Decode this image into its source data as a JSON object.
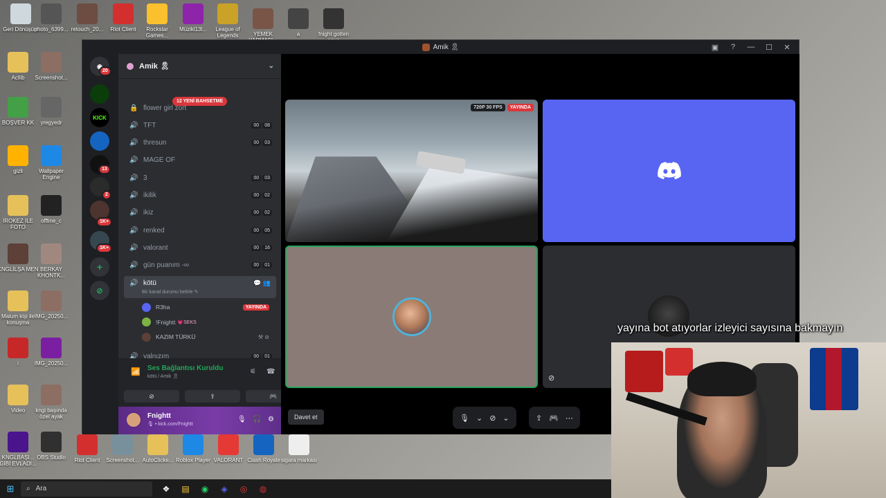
{
  "desktop": {
    "icons": [
      {
        "label": "Geri Dönüşüm",
        "color": "#cfd8dc"
      },
      {
        "label": "photo_6399...",
        "color": "#555"
      },
      {
        "label": "retouch_20...",
        "color": "#6d4c41"
      },
      {
        "label": "Riot Client",
        "color": "#d32f2f"
      },
      {
        "label": "Rockstar Games...",
        "color": "#fbc02d"
      },
      {
        "label": "Müzikl13l...",
        "color": "#8e24aa"
      },
      {
        "label": "League of Legends",
        "color": "#c9a227"
      },
      {
        "label": "YEMEK YAPMASI...",
        "color": "#795548"
      },
      {
        "label": "a",
        "color": "#444"
      },
      {
        "label": "fnight gotten amis",
        "color": "#333"
      },
      {
        "label": "Acllib",
        "color": "#e6c15a"
      },
      {
        "label": "Screenshot...",
        "color": "#8d6e63"
      },
      {
        "label": "BOŞVER KK",
        "color": "#43a047"
      },
      {
        "label": "yregyedr",
        "color": "#666"
      },
      {
        "label": "gizli",
        "color": "#ffb300"
      },
      {
        "label": "Wallpaper Engine",
        "color": "#1e88e5"
      },
      {
        "label": "İROKEZ İLE FOTO",
        "color": "#e6c15a"
      },
      {
        "label": "offline_c",
        "color": "#222"
      },
      {
        "label": "KNGLİLŞA MEN",
        "color": "#5d4037"
      },
      {
        "label": "BERKAY KHONTK...",
        "color": "#a1887f"
      },
      {
        "label": "Malum kişi ile konuşma",
        "color": "#e6c15a"
      },
      {
        "label": "IMG_20250...",
        "color": "#8d6e63"
      },
      {
        "label": "i",
        "color": "#c62828"
      },
      {
        "label": "IMG_20250...",
        "color": "#7b1fa2"
      },
      {
        "label": "Video",
        "color": "#e6c15a"
      },
      {
        "label": "kngi başında özel ayak",
        "color": "#8d6e63"
      },
      {
        "label": "KNGLBAŞI... GİBİ EVLADI...",
        "color": "#4a148c"
      },
      {
        "label": "OBS Studio",
        "color": "#303030"
      }
    ]
  },
  "discord": {
    "window_title": "Amik 🎗",
    "guild_name": "Amik 🎗",
    "mention_pill": "12 YENİ BAHSETME",
    "rail": {
      "home_badge": "20",
      "badges": [
        "13",
        "2",
        "1K+",
        "1K+"
      ],
      "kick_label": "KICK",
      "add_label": "+",
      "explore_label": "⊘"
    },
    "channels": [
      {
        "name": "flower girl zort",
        "locked": true,
        "counts": []
      },
      {
        "name": "TFT",
        "counts": [
          "00",
          "08"
        ]
      },
      {
        "name": "thresun",
        "counts": [
          "00",
          "03"
        ]
      },
      {
        "name": "MAGE OF",
        "counts": []
      },
      {
        "name": "3",
        "counts": [
          "00",
          "03"
        ]
      },
      {
        "name": "ikilik",
        "counts": [
          "00",
          "02"
        ]
      },
      {
        "name": "ikiz",
        "counts": [
          "00",
          "02"
        ]
      },
      {
        "name": "renked",
        "counts": [
          "00",
          "05"
        ]
      },
      {
        "name": "valorant",
        "counts": [
          "00",
          "16"
        ]
      },
      {
        "name": "gün puanım -∞",
        "counts": [
          "00",
          "01"
        ]
      }
    ],
    "active_channel": {
      "name": "kötü",
      "status_hint": "Bir kanal durumu belirle ✎"
    },
    "members": [
      {
        "name": "R3ha",
        "badge": "YAYINDA",
        "color": "#5865f2"
      },
      {
        "name": "!Fnightt",
        "suffix": "💗SEKS",
        "color": "#7cb342"
      },
      {
        "name": "KAZIM TÜRKÜ",
        "icons": "⚒ ⊘",
        "color": "#5d4037"
      }
    ],
    "after_channel": {
      "name": "yalnızım",
      "counts": [
        "00",
        "01"
      ]
    },
    "voice": {
      "status": "Ses Bağlantısı Kuruldu",
      "location": "kötü / Amik 🎗",
      "btn1": "⊘",
      "btn2": "⇪",
      "btn3": "🎮"
    },
    "user": {
      "name": "Fnightt",
      "sub": "🎙 • kick.com/Fnightt"
    },
    "stream_tags": {
      "quality": "720P 30 FPS",
      "live": "YAYINDA"
    },
    "invite_label": "Davet et",
    "hangup": "☎"
  },
  "overlay_caption": "yayına bot atıyorlar izleyici sayısına bakmayın",
  "taskbar": {
    "search_placeholder": "Ara",
    "apps": [
      "❖",
      "▤",
      "◉",
      "◈",
      "◎",
      "◍"
    ]
  },
  "bottom_icons": [
    {
      "label": "Riot Client",
      "color": "#d32f2f"
    },
    {
      "label": "Screenshot...",
      "color": "#78909c"
    },
    {
      "label": "AutoClicke...",
      "color": "#e6c15a"
    },
    {
      "label": "Roblox Player",
      "color": "#1e88e5"
    },
    {
      "label": "VALORANT",
      "color": "#e53935"
    },
    {
      "label": "Clash Royale",
      "color": "#1565c0"
    },
    {
      "label": "sigara markası",
      "color": "#eeeeee"
    }
  ]
}
